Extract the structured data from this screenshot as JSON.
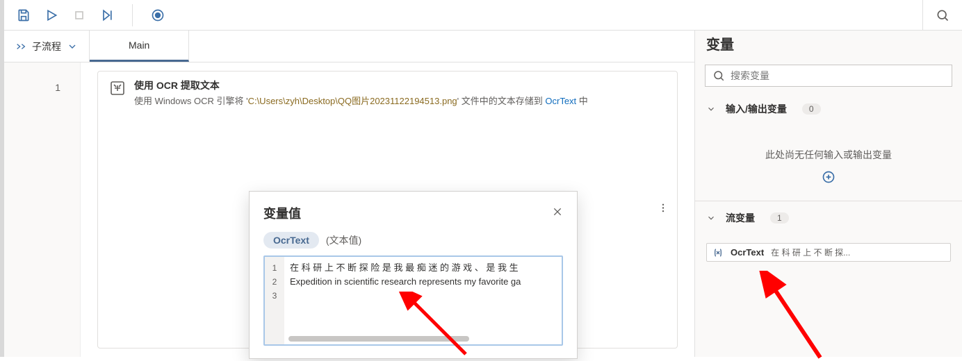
{
  "toolbar": {},
  "subflow_label": "子流程",
  "tabs": {
    "main": "Main"
  },
  "gutter_line": "1",
  "action": {
    "title": "使用 OCR 提取文本",
    "desc_prefix": "使用 Windows OCR 引擎将 '",
    "path": "C:\\Users\\zyh\\Desktop\\QQ图片20231122194513.png",
    "desc_middle": "' 文件中的文本存储到 ",
    "link": "OcrText",
    "desc_suffix": " 中"
  },
  "sidebar": {
    "title": "变量",
    "search_placeholder": "搜索变量",
    "io_section": {
      "title": "输入/输出变量",
      "count": "0",
      "empty": "此处尚无任何输入或输出变量"
    },
    "flow_section": {
      "title": "流变量",
      "count": "1",
      "items": [
        {
          "name": "OcrText",
          "preview": "在 科 研 上 不 断 探..."
        }
      ]
    }
  },
  "dialog": {
    "title": "变量值",
    "chip": "OcrText",
    "type": "(文本值)",
    "lines": [
      "1",
      "2",
      "3"
    ],
    "text_lines": [
      "在 科 研 上 不 断 探 险 是 我 最 痴 迷 的 游 戏 、 是 我 生",
      "Expedition in scientific research represents my favorite ga",
      ""
    ]
  }
}
